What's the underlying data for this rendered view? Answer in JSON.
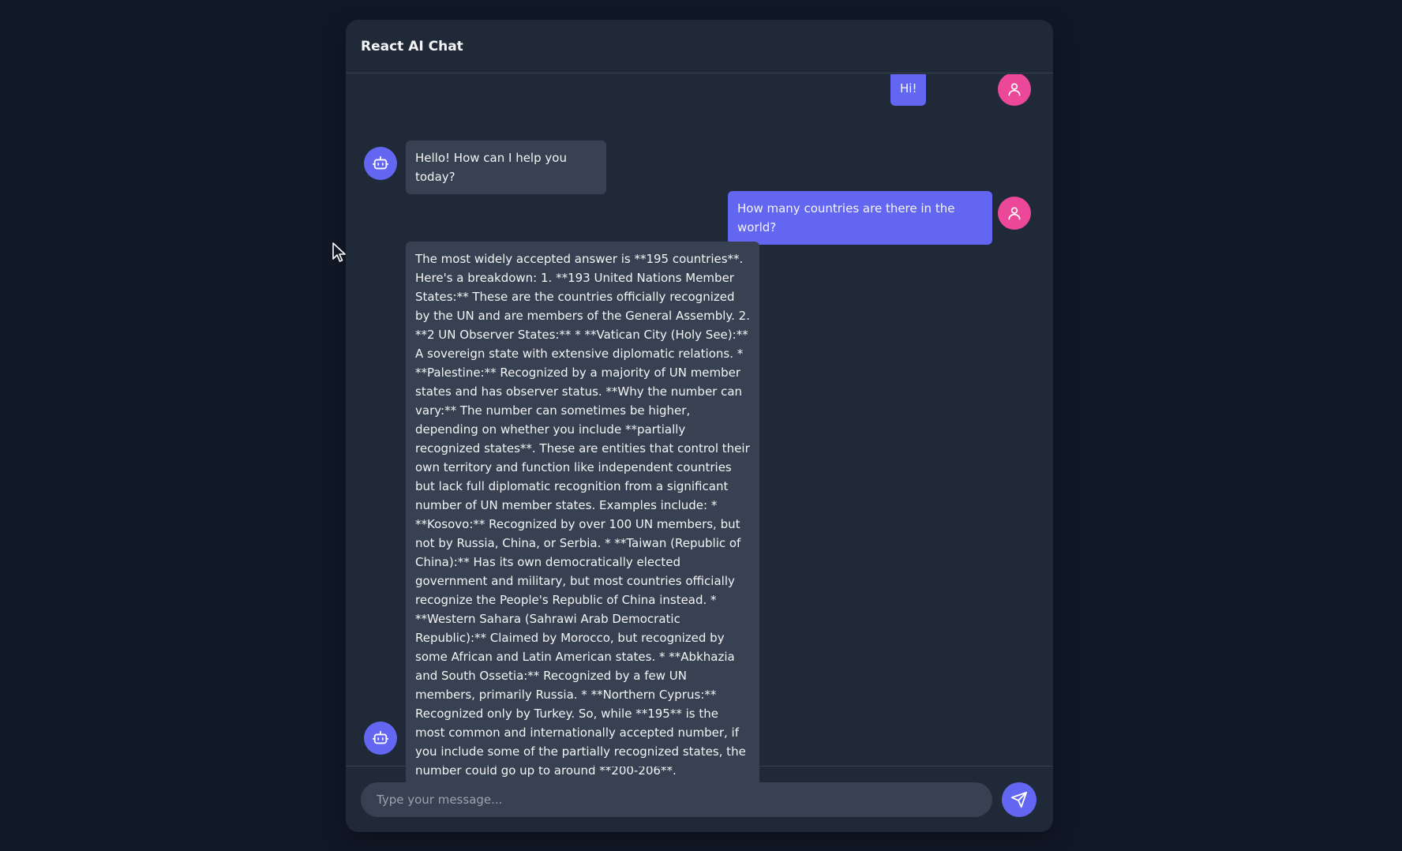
{
  "header": {
    "title": "React AI Chat"
  },
  "messages": [
    {
      "role": "user",
      "text": "Hi!"
    },
    {
      "role": "bot",
      "text": "Hello! How can I help you today?"
    },
    {
      "role": "user",
      "text": "How many countries are there in the world?"
    },
    {
      "role": "bot",
      "text": "The most widely accepted answer is **195 countries**. Here's a breakdown: 1. **193 United Nations Member States:** These are the countries officially recognized by the UN and are members of the General Assembly. 2. **2 UN Observer States:** * **Vatican City (Holy See):** A sovereign state with extensive diplomatic relations. * **Palestine:** Recognized by a majority of UN member states and has observer status. **Why the number can vary:** The number can sometimes be higher, depending on whether you include **partially recognized states**. These are entities that control their own territory and function like independent countries but lack full diplomatic recognition from a significant number of UN member states. Examples include: * **Kosovo:** Recognized by over 100 UN members, but not by Russia, China, or Serbia. * **Taiwan (Republic of China):** Has its own democratically elected government and military, but most countries officially recognize the People's Republic of China instead. * **Western Sahara (Sahrawi Arab Democratic Republic):** Claimed by Morocco, but recognized by some African and Latin American states. * **Abkhazia and South Ossetia:** Recognized by a few UN members, primarily Russia. * **Northern Cyprus:** Recognized only by Turkey. So, while **195** is the most common and internationally accepted number, if you include some of the partially recognized states, the number could go up to around **200-206**."
    }
  ],
  "composer": {
    "placeholder": "Type your message...",
    "send_icon": "send-icon"
  },
  "icons": {
    "user_avatar": "user-icon",
    "bot_avatar": "bot-icon"
  },
  "colors": {
    "page_background": "#111827",
    "panel_background": "#1f2937",
    "user_bubble": "#6366f1",
    "bot_bubble": "#374151",
    "user_avatar": "#ec4899",
    "bot_avatar": "#6366f1",
    "text": "#f3f4f6"
  }
}
